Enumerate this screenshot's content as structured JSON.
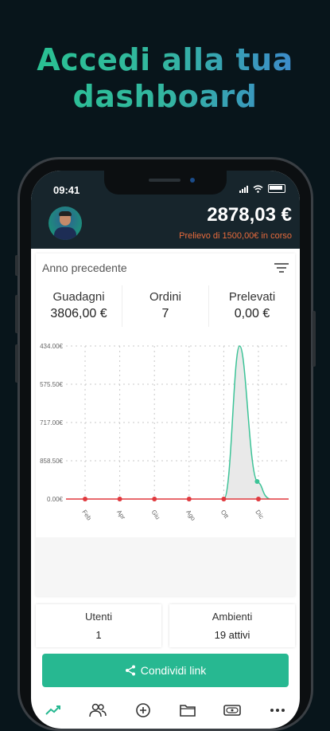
{
  "headline": {
    "line1": "Accedi alla tua",
    "line2": "dashboard"
  },
  "status_bar": {
    "time": "09:41"
  },
  "header": {
    "balance": "2878,03 €",
    "withdraw_note": "Prelievo di 1500,00€ in corso"
  },
  "card": {
    "period": "Anno precedente",
    "stats": [
      {
        "label": "Guadagni",
        "value": "3806,00 €"
      },
      {
        "label": "Ordini",
        "value": "7"
      },
      {
        "label": "Prelevati",
        "value": "0,00 €"
      }
    ]
  },
  "chart_data": {
    "type": "area",
    "x": [
      "Feb",
      "Apr",
      "Giu",
      "Ago",
      "Ott",
      "Dic"
    ],
    "y_tick_labels": [
      "434.00€",
      "575.50€",
      "717.00€",
      "858.50€",
      "0.00€"
    ],
    "series": [
      {
        "values": [
          0,
          0,
          0,
          0,
          0,
          0
        ]
      }
    ],
    "peak": {
      "x": "Nov",
      "value": 434.0
    },
    "colors": {
      "line": "#3cc397",
      "markers": "#e0393e",
      "fill": "#e9e9e9",
      "grid": "#c9c9c9"
    }
  },
  "summary": [
    {
      "label": "Utenti",
      "value": "1"
    },
    {
      "label": "Ambienti",
      "value": "19 attivi"
    }
  ],
  "share_button": {
    "label": "Condividi link"
  },
  "tabbar": {
    "icons": [
      "trend-icon",
      "users-icon",
      "add-circle-icon",
      "folder-icon",
      "wallet-icon",
      "more-icon"
    ]
  },
  "colors": {
    "accent": "#27b891",
    "withdraw": "#e86b3c",
    "header_bg": "#17252c",
    "page_bg": "#08151b"
  }
}
